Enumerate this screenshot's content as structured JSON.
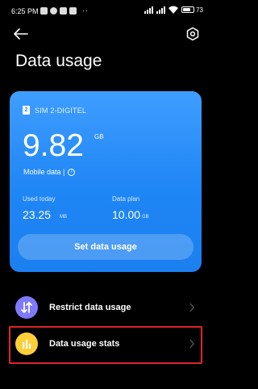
{
  "status_bar": {
    "time": "6:25 PM",
    "battery": "73"
  },
  "header": {
    "title": "Data usage"
  },
  "card": {
    "sim_label": "SIM 2-DIGITEL",
    "sim_number": "2",
    "total_value": "9.82",
    "total_unit": "GB",
    "mobile_label": "Mobile data |",
    "used_today_label": "Used today",
    "used_today_value": "23.25",
    "used_today_unit": "MB",
    "plan_label": "Data plan",
    "plan_value": "10.00",
    "plan_unit": "GB",
    "set_button": "Set data usage",
    "colors": {
      "top": "#3f9dff",
      "bottom": "#1b7ff0"
    }
  },
  "menu": {
    "restrict_label": "Restrict data usage",
    "stats_label": "Data usage stats",
    "colors": {
      "restrict_icon": "#7e79ff",
      "stats_icon": "#ffcf3a",
      "highlight": "#e0242c"
    }
  }
}
